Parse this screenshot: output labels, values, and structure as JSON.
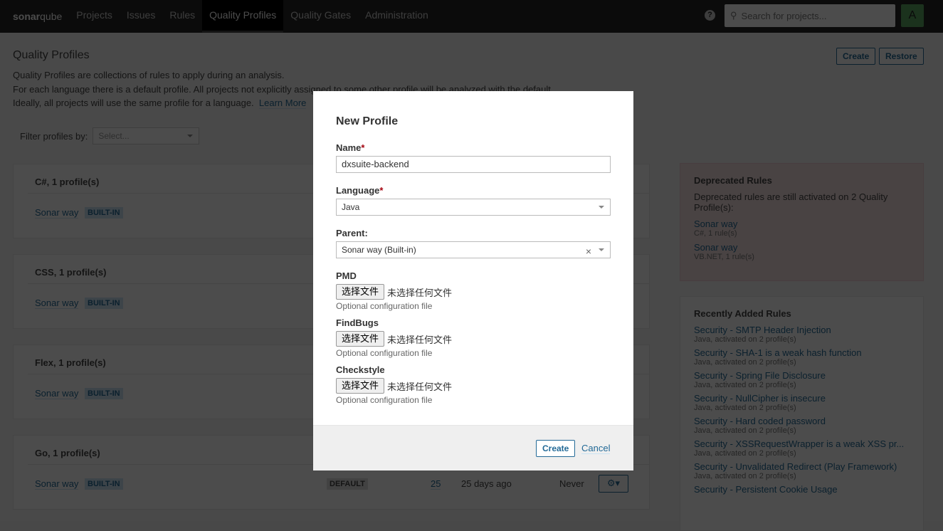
{
  "nav": {
    "logo_bold": "sonar",
    "logo_rest": "qube",
    "items": [
      "Projects",
      "Issues",
      "Rules",
      "Quality Profiles",
      "Quality Gates",
      "Administration"
    ],
    "active": "Quality Profiles",
    "help": "?",
    "search_placeholder": "Search for projects...",
    "avatar": "A"
  },
  "page": {
    "title": "Quality Profiles",
    "desc1": "Quality Profiles are collections of rules to apply during an analysis.",
    "desc2": "For each language there is a default profile. All projects not explicitly assigned to some other profile will be analyzed with the default.",
    "desc3": "Ideally, all projects will use the same profile for a language.",
    "learn_more": "Learn More",
    "create": "Create",
    "restore": "Restore",
    "filter_label": "Filter profiles by:",
    "filter_placeholder": "Select..."
  },
  "languages": [
    {
      "header": "C#, 1 profile(s)",
      "profile": "Sonar way",
      "badge": "BUILT-IN"
    },
    {
      "header": "CSS, 1 profile(s)",
      "profile": "Sonar way",
      "badge": "BUILT-IN"
    },
    {
      "header": "Flex, 1 profile(s)",
      "profile": "Sonar way",
      "badge": "BUILT-IN"
    },
    {
      "header": "Go, 1 profile(s)",
      "profile": "Sonar way",
      "badge": "BUILT-IN",
      "default": "DEFAULT",
      "rules": "25",
      "updated": "25 days ago",
      "used": "Never"
    }
  ],
  "deprecated": {
    "title": "Deprecated Rules",
    "text": "Deprecated rules are still activated on 2 Quality Profile(s):",
    "items": [
      {
        "name": "Sonar way",
        "sub": "C#, 1 rule(s)"
      },
      {
        "name": "Sonar way",
        "sub": "VB.NET, 1 rule(s)"
      }
    ]
  },
  "recent": {
    "title": "Recently Added Rules",
    "items": [
      {
        "name": "Security - SMTP Header Injection",
        "sub": "Java, activated on 2 profile(s)"
      },
      {
        "name": "Security - SHA-1 is a weak hash function",
        "sub": "Java, activated on 2 profile(s)"
      },
      {
        "name": "Security - Spring File Disclosure",
        "sub": "Java, activated on 2 profile(s)"
      },
      {
        "name": "Security - NullCipher is insecure",
        "sub": "Java, activated on 2 profile(s)"
      },
      {
        "name": "Security - Hard coded password",
        "sub": "Java, activated on 2 profile(s)"
      },
      {
        "name": "Security - XSSRequestWrapper is a weak XSS pr...",
        "sub": "Java, activated on 2 profile(s)"
      },
      {
        "name": "Security - Unvalidated Redirect (Play Framework)",
        "sub": "Java, activated on 2 profile(s)"
      },
      {
        "name": "Security - Persistent Cookie Usage",
        "sub": ""
      }
    ]
  },
  "modal": {
    "title": "New Profile",
    "name_label": "Name",
    "name_value": "dxsuite-backend",
    "language_label": "Language",
    "language_value": "Java",
    "parent_label": "Parent:",
    "parent_value": "Sonar way (Built-in)",
    "required": "*",
    "files": [
      {
        "label": "PMD"
      },
      {
        "label": "FindBugs"
      },
      {
        "label": "Checkstyle"
      }
    ],
    "choose_file": "选择文件",
    "no_file": "未选择任何文件",
    "hint": "Optional configuration file",
    "create": "Create",
    "cancel": "Cancel"
  }
}
